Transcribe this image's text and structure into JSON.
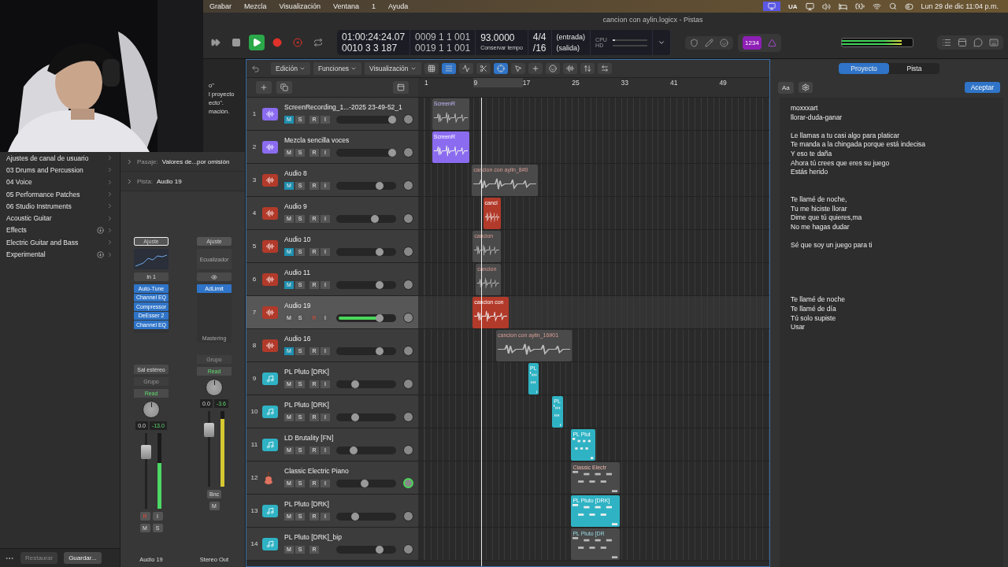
{
  "menu_bar": {
    "items": [
      "Grabar",
      "Mezcla",
      "Visualización",
      "Ventana",
      "1",
      "Ayuda"
    ],
    "keyboard": "UA",
    "clock": "Lun 29 de dic  11:04 p.m."
  },
  "window": {
    "title": "cancion con aylin.logicx - Pistas"
  },
  "webcam": {
    "kind": "picture"
  },
  "transport": [
    {
      "kind": "forward",
      "active": false
    },
    {
      "kind": "stop",
      "active": false
    },
    {
      "kind": "play",
      "active": true
    },
    {
      "kind": "record",
      "active": false
    },
    {
      "kind": "capture",
      "active": false
    },
    {
      "kind": "cycle",
      "active": false
    }
  ],
  "lcd": {
    "time": "01:00:24:24.07",
    "position": "0010  3  3  187",
    "locator_left": "0009  1  1  001",
    "locator_right": "0019  1  1  001",
    "tempo": "93.0000",
    "tempo_mode": "Conservar tempo",
    "signature": "4/4",
    "division": "/16",
    "input": "(entrada)",
    "output": "(salida)",
    "cpu_label": "CPU",
    "hd_label": "HD",
    "cpu": {
      "level": 0.06
    },
    "hd": {
      "level": 0.0
    }
  },
  "count_in": {
    "label": "1234",
    "on": true
  },
  "master_meter": {
    "level": 0.85
  },
  "help_text": [
    "o\"",
    "l proyecto",
    "ecto\".",
    "mación."
  ],
  "library": {
    "items": [
      {
        "label": "Ajustes de canal de usuario",
        "downloadable": false
      },
      {
        "label": "03 Drums and Percussion",
        "downloadable": false
      },
      {
        "label": "04 Voice",
        "downloadable": false
      },
      {
        "label": "05 Performance Patches",
        "downloadable": false
      },
      {
        "label": "06 Studio Instruments",
        "downloadable": false
      },
      {
        "label": "Acoustic Guitar",
        "downloadable": false
      },
      {
        "label": "Effects",
        "downloadable": true
      },
      {
        "label": "Electric Guitar and Bass",
        "downloadable": false
      },
      {
        "label": "Experimental",
        "downloadable": true
      }
    ],
    "buttons": [
      "Restaurar",
      "Guardar..."
    ]
  },
  "inspector": {
    "rows": [
      {
        "label": "Pasaje:",
        "value": "Valores de...por omisión"
      },
      {
        "label": "Pista:",
        "value": "Audio 19"
      }
    ],
    "strips": [
      {
        "name": "Audio 19",
        "selected": true,
        "setting": "Ajuste",
        "eq": {
          "kind": "graph"
        },
        "input": "In 1",
        "plugins": [
          "Auto-Tune",
          "Channel EQ",
          "Compressor",
          "DeEsser 2",
          "Channel EQ"
        ],
        "output": "Sal estéreo",
        "group": "Grupo",
        "automation": "Read",
        "pan_value": "0.0",
        "volume": "-13.0",
        "fader": {
          "level": 0.75
        },
        "meter": {
          "level": 0.6,
          "color": "#4cd964"
        },
        "extra_buttons": [
          {
            "label": "R",
            "on": true
          },
          {
            "label": "I",
            "on": false
          }
        ],
        "buttons": [
          "M",
          "S"
        ]
      },
      {
        "name": "Stereo Out",
        "selected": false,
        "setting": "Ajuste",
        "eq": {
          "kind": "label",
          "label": "Ecualizador"
        },
        "plugins": [
          "AdLimit"
        ],
        "footer": "Mastering",
        "group": "Grupo",
        "automation": "Read",
        "pan_value": "0.0",
        "volume": "-3.6",
        "fader": {
          "level": 0.75
        },
        "meter": {
          "level": 0.9,
          "color": "#d6c830"
        },
        "extra_buttons": [
          {
            "label": "Bnc",
            "on": false
          }
        ],
        "buttons": [
          "M"
        ]
      }
    ]
  },
  "tracks_toolbar": {
    "menus": [
      "Edición",
      "Funciones",
      "Visualización"
    ]
  },
  "ruler": [
    "1",
    "9",
    "17",
    "25",
    "33",
    "41",
    "49"
  ],
  "playhead": {
    "level": 0.181
  },
  "tracks": [
    {
      "number": "1",
      "name": "ScreenRecording_1...-2025 23-49-52_1",
      "kind": "audio",
      "color": "#8b6cf0",
      "selected": false,
      "knob_lit": false,
      "volume": {
        "level": 0.93
      },
      "buttons": [
        {
          "label": "M",
          "kind": "mute",
          "on": true
        },
        {
          "label": "S",
          "kind": "solo",
          "on": false
        },
        {
          "label": "R",
          "kind": "record",
          "on": false
        },
        {
          "label": "I",
          "kind": "monitor",
          "on": false
        }
      ],
      "regions": [
        {
          "label": "ScreenR",
          "kind": "audio",
          "start": {
            "level": 0.04
          },
          "length": {
            "level": 0.106
          },
          "muted": true
        }
      ]
    },
    {
      "number": "2",
      "name": "Mezcla sencilla voces",
      "kind": "audio",
      "color": "#8b6cf0",
      "selected": false,
      "knob_lit": false,
      "volume": {
        "level": 0.93
      },
      "buttons": [
        {
          "label": "M",
          "kind": "mute",
          "on": false
        },
        {
          "label": "S",
          "kind": "solo",
          "on": false
        },
        {
          "label": "R",
          "kind": "record",
          "on": false
        },
        {
          "label": "I",
          "kind": "monitor",
          "on": false
        }
      ],
      "regions": [
        {
          "label": "ScreenR",
          "kind": "audio",
          "start": {
            "level": 0.04
          },
          "length": {
            "level": 0.106
          },
          "muted": false
        }
      ]
    },
    {
      "number": "3",
      "name": "Audio 8",
      "kind": "audio",
      "color": "#b23a2a",
      "selected": false,
      "knob_lit": false,
      "volume": {
        "level": 0.72
      },
      "buttons": [
        {
          "label": "M",
          "kind": "mute",
          "on": true
        },
        {
          "label": "S",
          "kind": "solo",
          "on": false
        },
        {
          "label": "R",
          "kind": "record",
          "on": false
        },
        {
          "label": "I",
          "kind": "monitor",
          "on": false
        }
      ],
      "regions": [
        {
          "label": "cancion con aylin_8#0",
          "kind": "audio",
          "start": {
            "level": 0.153
          },
          "length": {
            "level": 0.188
          },
          "muted": true
        }
      ]
    },
    {
      "number": "4",
      "name": "Audio 9",
      "kind": "audio",
      "color": "#b23a2a",
      "selected": false,
      "knob_lit": false,
      "volume": {
        "level": 0.65
      },
      "buttons": [
        {
          "label": "M",
          "kind": "mute",
          "on": false
        },
        {
          "label": "S",
          "kind": "solo",
          "on": false
        },
        {
          "label": "R",
          "kind": "record",
          "on": false
        },
        {
          "label": "I",
          "kind": "monitor",
          "on": false
        }
      ],
      "regions": [
        {
          "label": "canci",
          "kind": "audio",
          "start": {
            "level": 0.185
          },
          "length": {
            "level": 0.05
          },
          "muted": false
        }
      ]
    },
    {
      "number": "5",
      "name": "Audio 10",
      "kind": "audio",
      "color": "#b23a2a",
      "selected": false,
      "knob_lit": false,
      "volume": {
        "level": 0.72
      },
      "buttons": [
        {
          "label": "M",
          "kind": "mute",
          "on": true
        },
        {
          "label": "S",
          "kind": "solo",
          "on": false
        },
        {
          "label": "R",
          "kind": "record",
          "on": false
        },
        {
          "label": "I",
          "kind": "monitor",
          "on": false
        }
      ],
      "regions": [
        {
          "label": "cancion",
          "kind": "audio",
          "start": {
            "level": 0.155
          },
          "length": {
            "level": 0.08
          },
          "muted": true
        }
      ]
    },
    {
      "number": "6",
      "name": "Audio 11",
      "kind": "audio",
      "color": "#b23a2a",
      "selected": false,
      "knob_lit": false,
      "volume": {
        "level": 0.72
      },
      "buttons": [
        {
          "label": "M",
          "kind": "mute",
          "on": true
        },
        {
          "label": "S",
          "kind": "solo",
          "on": false
        },
        {
          "label": "R",
          "kind": "record",
          "on": false
        },
        {
          "label": "I",
          "kind": "monitor",
          "on": false
        }
      ],
      "regions": [
        {
          "label": "cancion",
          "kind": "audio",
          "start": {
            "level": 0.164
          },
          "length": {
            "level": 0.071
          },
          "muted": true
        }
      ]
    },
    {
      "number": "7",
      "name": "Audio 19",
      "kind": "audio",
      "color": "#b23a2a",
      "selected": true,
      "knob_lit": false,
      "volume": {
        "level": 0.72
      },
      "buttons": [
        {
          "label": "M",
          "kind": "mute",
          "on": false
        },
        {
          "label": "S",
          "kind": "solo",
          "on": false
        },
        {
          "label": "R",
          "kind": "record",
          "on": true
        },
        {
          "label": "I",
          "kind": "monitor",
          "on": false
        }
      ],
      "regions": [
        {
          "label": "cancion con",
          "kind": "audio",
          "start": {
            "level": 0.155
          },
          "length": {
            "level": 0.103
          },
          "muted": false
        }
      ]
    },
    {
      "number": "8",
      "name": "Audio 16",
      "kind": "audio",
      "color": "#b23a2a",
      "selected": false,
      "knob_lit": false,
      "volume": {
        "level": 0.72
      },
      "buttons": [
        {
          "label": "M",
          "kind": "mute",
          "on": true
        },
        {
          "label": "S",
          "kind": "solo",
          "on": false
        },
        {
          "label": "R",
          "kind": "record",
          "on": false
        },
        {
          "label": "I",
          "kind": "monitor",
          "on": false
        }
      ],
      "regions": [
        {
          "label": "cancion con aylin_16#01",
          "kind": "audio",
          "start": {
            "level": 0.222
          },
          "length": {
            "level": 0.216
          },
          "muted": true
        }
      ]
    },
    {
      "number": "9",
      "name": "PL Pluto [DRK]",
      "kind": "midi",
      "color": "#2fb3c4",
      "selected": false,
      "knob_lit": false,
      "volume": {
        "level": 0.32
      },
      "buttons": [
        {
          "label": "M",
          "kind": "mute",
          "on": false
        },
        {
          "label": "S",
          "kind": "solo",
          "on": false
        },
        {
          "label": "R",
          "kind": "record",
          "on": false
        },
        {
          "label": "I",
          "kind": "monitor",
          "on": false
        }
      ],
      "regions": [
        {
          "label": "PL",
          "kind": "midi",
          "start": {
            "level": 0.314
          },
          "length": {
            "level": 0.03
          },
          "muted": false
        }
      ]
    },
    {
      "number": "10",
      "name": "PL Pluto [DRK]",
      "kind": "midi",
      "color": "#2fb3c4",
      "selected": false,
      "knob_lit": false,
      "volume": {
        "level": 0.32
      },
      "buttons": [
        {
          "label": "M",
          "kind": "mute",
          "on": false
        },
        {
          "label": "S",
          "kind": "solo",
          "on": false
        },
        {
          "label": "R",
          "kind": "record",
          "on": false
        },
        {
          "label": "I",
          "kind": "monitor",
          "on": false
        }
      ],
      "regions": [
        {
          "label": "PL",
          "kind": "midi",
          "start": {
            "level": 0.382
          },
          "length": {
            "level": 0.03
          },
          "muted": false
        }
      ]
    },
    {
      "number": "11",
      "name": "LD Brutality [FN]",
      "kind": "midi",
      "color": "#2fb3c4",
      "selected": false,
      "knob_lit": false,
      "volume": {
        "level": 0.29
      },
      "buttons": [
        {
          "label": "M",
          "kind": "mute",
          "on": false
        },
        {
          "label": "S",
          "kind": "solo",
          "on": false
        },
        {
          "label": "R",
          "kind": "record",
          "on": false
        },
        {
          "label": "I",
          "kind": "monitor",
          "on": false
        }
      ],
      "regions": [
        {
          "label": "PL Plut",
          "kind": "midi",
          "start": {
            "level": 0.436
          },
          "length": {
            "level": 0.068
          },
          "muted": false
        }
      ]
    },
    {
      "number": "12",
      "name": "Classic Electric Piano",
      "kind": "instrument",
      "color": "#e0735f",
      "selected": false,
      "knob_lit": true,
      "volume": {
        "level": 0.47
      },
      "buttons": [
        {
          "label": "M",
          "kind": "mute",
          "on": false
        },
        {
          "label": "S",
          "kind": "solo",
          "on": false
        },
        {
          "label": "R",
          "kind": "record",
          "on": false
        },
        {
          "label": "I",
          "kind": "monitor",
          "on": false
        }
      ],
      "regions": [
        {
          "label": "Classic Electr",
          "kind": "midi",
          "start": {
            "level": 0.436
          },
          "length": {
            "level": 0.137
          },
          "muted": true
        }
      ]
    },
    {
      "number": "13",
      "name": "PL Pluto [DRK]",
      "kind": "midi",
      "color": "#2fb3c4",
      "selected": false,
      "knob_lit": false,
      "volume": {
        "level": 0.32
      },
      "buttons": [
        {
          "label": "M",
          "kind": "mute",
          "on": false
        },
        {
          "label": "S",
          "kind": "solo",
          "on": false
        },
        {
          "label": "R",
          "kind": "record",
          "on": false
        },
        {
          "label": "I",
          "kind": "monitor",
          "on": false
        }
      ],
      "regions": [
        {
          "label": "PL Pluto [DRK]",
          "kind": "midi",
          "start": {
            "level": 0.436
          },
          "length": {
            "level": 0.137
          },
          "muted": false
        }
      ]
    },
    {
      "number": "14",
      "name": "PL Pluto [DRK]_bip",
      "kind": "midi",
      "color": "#2fb3c4",
      "selected": false,
      "knob_lit": false,
      "volume": {
        "level": 0.73
      },
      "buttons": [
        {
          "label": "M",
          "kind": "mute",
          "on": false
        },
        {
          "label": "S",
          "kind": "solo",
          "on": false
        },
        {
          "label": "R",
          "kind": "record",
          "on": false
        }
      ],
      "regions": [
        {
          "label": "PL Pluto [DR",
          "kind": "midi",
          "start": {
            "level": 0.436
          },
          "length": {
            "level": 0.137
          },
          "muted": true
        }
      ]
    }
  ],
  "notes": {
    "tabs": [
      {
        "label": "Proyecto",
        "selected": true
      },
      {
        "label": "Pista",
        "selected": false
      }
    ],
    "font_button": "Aa",
    "accept": "Aceptar",
    "lines": [
      {
        "kind": "text",
        "text": "moxxxart"
      },
      {
        "kind": "text",
        "text": "llorar-duda-ganar"
      },
      {
        "kind": "blank"
      },
      {
        "kind": "text",
        "text": "Le llamas a tu casi algo para platicar"
      },
      {
        "kind": "text",
        "text": "Te manda a la chingada porque está indecisa"
      },
      {
        "kind": "text",
        "text": "Y eso te daña"
      },
      {
        "kind": "text",
        "text": "Ahora tú crees que eres su juego"
      },
      {
        "kind": "text",
        "text": "Estás herido"
      },
      {
        "kind": "blank"
      },
      {
        "kind": "blank"
      },
      {
        "kind": "text",
        "text": "Te llamé de noche,"
      },
      {
        "kind": "text",
        "text": "Tu me hiciste llorar"
      },
      {
        "kind": "text",
        "text": "Dime que tú quieres,ma"
      },
      {
        "kind": "text",
        "text": "No me hagas dudar"
      },
      {
        "kind": "blank"
      },
      {
        "kind": "text",
        "text": "Sé que soy un juego para ti"
      },
      {
        "kind": "blank"
      },
      {
        "kind": "blank"
      },
      {
        "kind": "blank"
      },
      {
        "kind": "blank"
      },
      {
        "kind": "blank"
      },
      {
        "kind": "text",
        "text": "Te llamé de noche"
      },
      {
        "kind": "text",
        "text": "Te llamé de día"
      },
      {
        "kind": "text",
        "text": "Tú solo supiste"
      },
      {
        "kind": "text",
        "text": "Usar"
      }
    ]
  }
}
